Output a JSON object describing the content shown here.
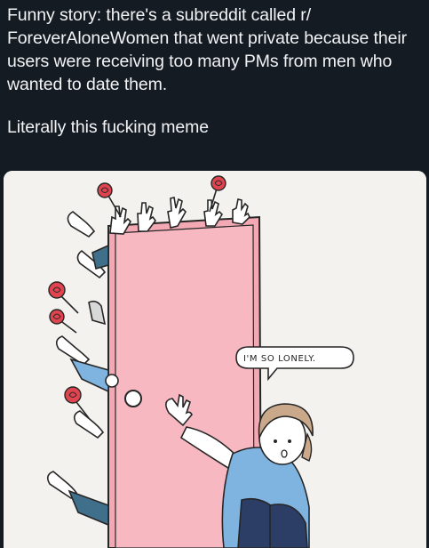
{
  "post": {
    "text_paragraph_1": "Funny story: there's a subreddit called r/ ForeverAloneWomen that went private because their users were receiving too many PMs from men who wanted to date them.",
    "text_paragraph_2": "Literally this fucking meme"
  },
  "meme": {
    "speech_bubble": "I'M SO LONELY."
  },
  "colors": {
    "background": "#151b23",
    "text": "#f2f3f5",
    "door_pink": "#f3a9b4",
    "door_frame": "#e78a97",
    "shirt_blue": "#7fb3e0",
    "rose_red": "#e0444f"
  }
}
